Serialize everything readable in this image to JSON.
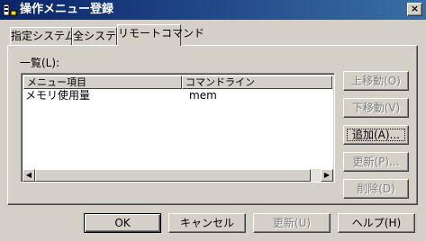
{
  "window": {
    "title": "操作メニュー登録",
    "close_glyph": "×",
    "app_icon": "dialog-app-icon"
  },
  "tabs": [
    {
      "label": "指定システム",
      "active": false
    },
    {
      "label": "全システム",
      "active": false
    },
    {
      "label": "リモートコマンド",
      "active": true
    }
  ],
  "list": {
    "label": "一覧(L):",
    "columns": [
      "メニュー項目",
      "コマンドライン"
    ],
    "rows": [
      {
        "menu_item": "メモリ使用量",
        "command_line": "mem"
      }
    ],
    "scroll_left_glyph": "◀",
    "scroll_right_glyph": "▶"
  },
  "side_buttons": {
    "move_up": "上移動(O)",
    "move_down": "下移動(V)",
    "add": "追加(A)...",
    "update": "更新(P)...",
    "delete": "削除(D)"
  },
  "bottom_buttons": {
    "ok": "OK",
    "cancel": "キャンセル",
    "update": "更新(U)",
    "help": "ヘルプ(H)"
  }
}
